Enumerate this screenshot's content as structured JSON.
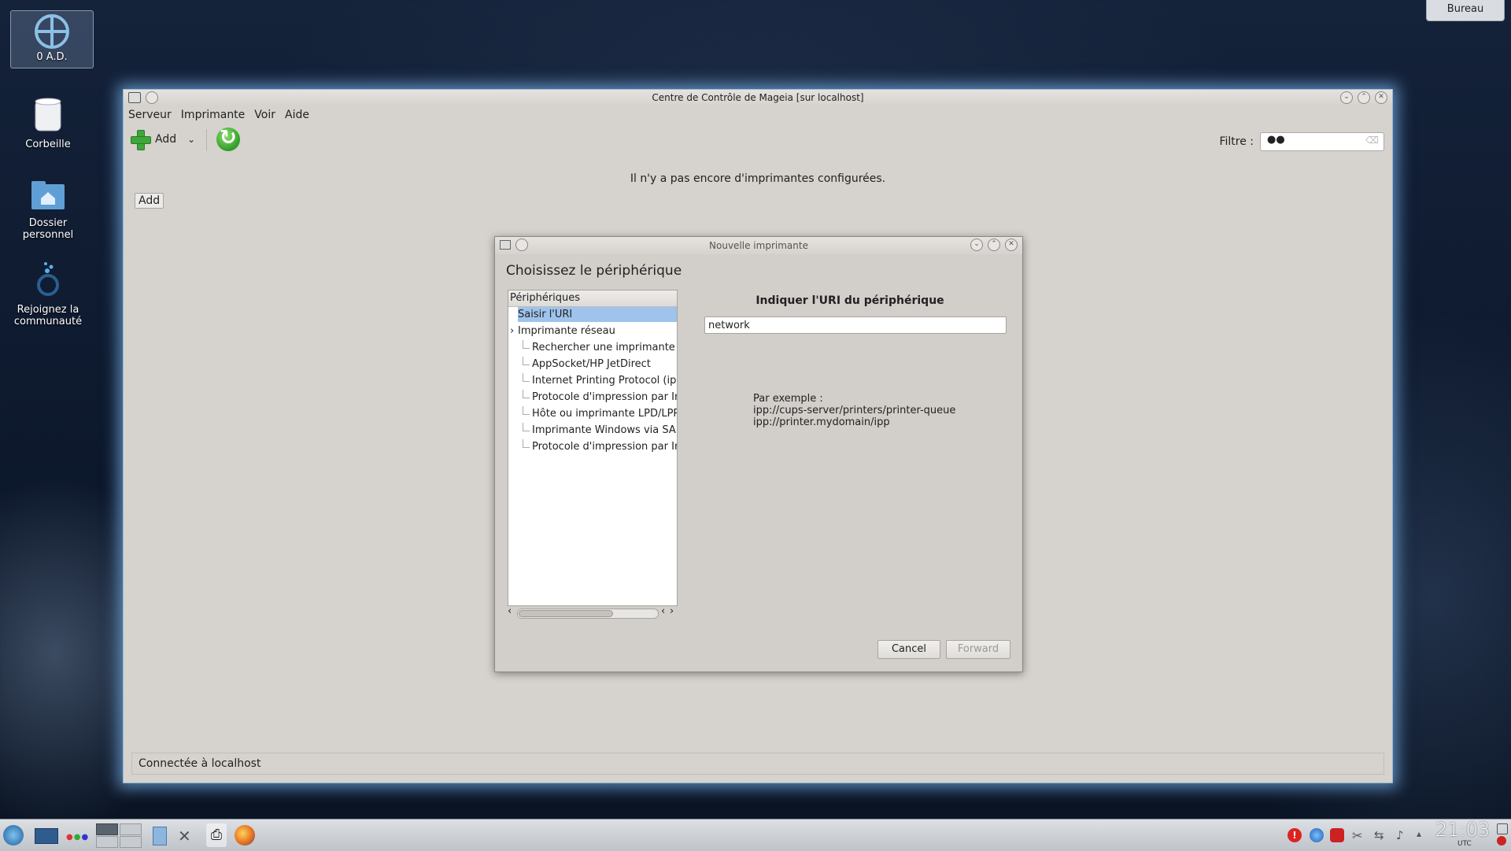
{
  "desktop": {
    "icons": [
      {
        "label": "0 A.D."
      },
      {
        "label": "Corbeille"
      },
      {
        "label": "Dossier personnel"
      },
      {
        "label": "Rejoignez la communauté"
      }
    ],
    "bureau_label": "Bureau"
  },
  "main_window": {
    "title": "Centre de Contrôle de Mageia  [sur localhost]",
    "menu": [
      "Serveur",
      "Imprimante",
      "Voir",
      "Aide"
    ],
    "toolbar": {
      "add_label": "Add"
    },
    "filter_label": "Filtre :",
    "empty_message": "Il n'y a pas encore d'imprimantes configurées.",
    "add_button": "Add",
    "status": "Connectée à localhost"
  },
  "dialog": {
    "title": "Nouvelle imprimante",
    "heading": "Choisissez le périphérique",
    "tree_header": "Périphériques",
    "tree_items": [
      {
        "label": "Saisir l'URI",
        "level": 0,
        "selected": true
      },
      {
        "label": "Imprimante réseau",
        "level": 0,
        "expander": "›"
      },
      {
        "label": "Rechercher une imprimante r",
        "level": 1
      },
      {
        "label": "AppSocket/HP JetDirect",
        "level": 1
      },
      {
        "label": "Internet Printing Protocol (ipp",
        "level": 1
      },
      {
        "label": "Protocole d'impression par In",
        "level": 1
      },
      {
        "label": "Hôte ou imprimante LPD/LPR",
        "level": 1
      },
      {
        "label": "Imprimante Windows via SAM",
        "level": 1
      },
      {
        "label": "Protocole d'impression par In",
        "level": 1
      }
    ],
    "uri_title": "Indiquer l'URI du périphérique",
    "uri_value": "network",
    "example_lines": [
      "Par exemple :",
      "ipp://cups-server/printers/printer-queue",
      "ipp://printer.mydomain/ipp"
    ],
    "cancel_label": "Cancel",
    "forward_label": "Forward"
  },
  "taskbar": {
    "clock": "21:03",
    "timezone": "UTC"
  },
  "colors": {
    "selection": "#9ec3ec",
    "window_bg": "#d6d2cd",
    "glow": "#78b4eb"
  }
}
